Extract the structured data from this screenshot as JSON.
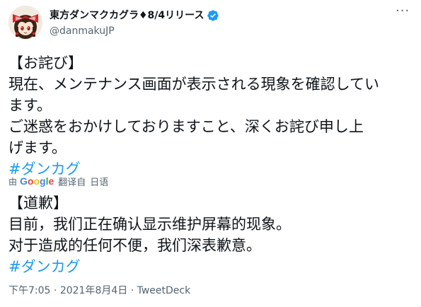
{
  "author": {
    "display_name": "東方ダンマクカグラ♦8/4リリース",
    "handle": "@danmakuJP",
    "verified_icon": "verified-badge-icon"
  },
  "tweet": {
    "original_lines": [
      "【お詫び】",
      "現在、メンテナンス画面が表示される現象を確認してい",
      "ます。",
      "ご迷惑をおかけしておりますこと、深くお詫び申し上",
      "げます。"
    ],
    "hashtag": "#ダンカグ"
  },
  "translation": {
    "by_label": "由",
    "google": [
      "G",
      "o",
      "o",
      "g",
      "l",
      "e"
    ],
    "translated_label": "翻译自",
    "language": "日语",
    "lines": [
      "【道歉】",
      "目前，我们正在确认显示维护屏幕的现象。",
      "对于造成的任何不便，我们深表歉意。"
    ],
    "hashtag": "#ダンカグ"
  },
  "meta": {
    "time": "下午7:05",
    "separator": "·",
    "date": "2021年8月4日",
    "source": "TweetDeck"
  },
  "colors": {
    "link": "#1d9bf0",
    "secondary_text": "#536471",
    "primary_text": "#0f1419"
  }
}
